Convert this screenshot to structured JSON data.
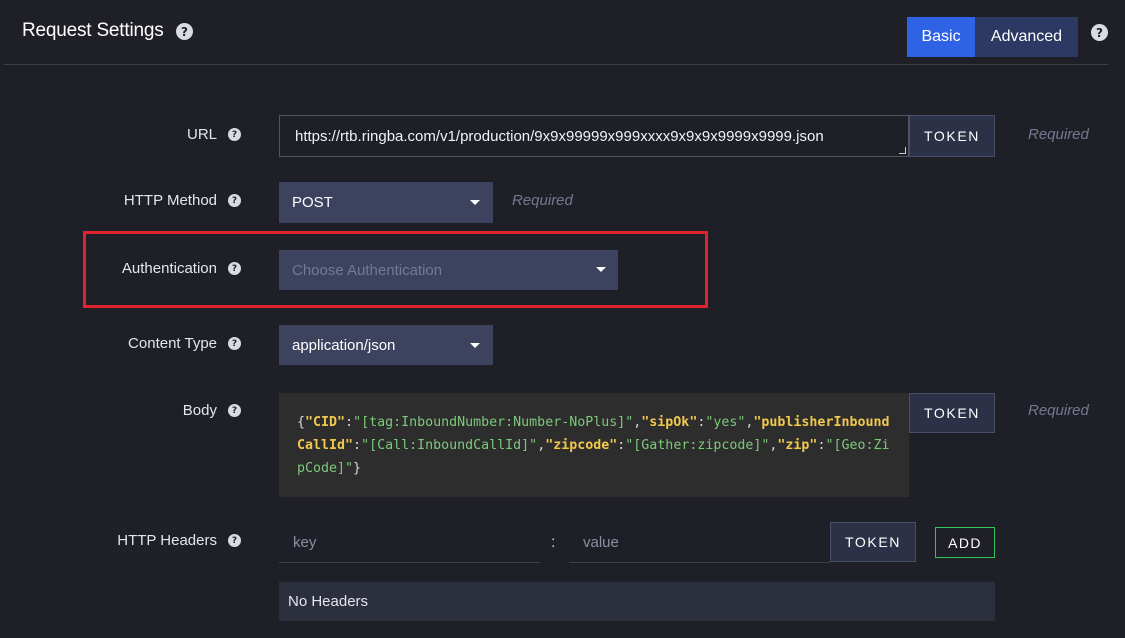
{
  "header": {
    "title": "Request Settings",
    "help_glyph": "?",
    "modes": {
      "basic": "Basic",
      "advanced": "Advanced",
      "active": "Basic"
    }
  },
  "url": {
    "label": "URL",
    "value": "https://rtb.ringba.com/v1/production/9x9x99999x999xxxx9x9x9x9999x9999.json",
    "token": "TOKEN",
    "required": "Required"
  },
  "http_method": {
    "label": "HTTP Method",
    "value": "POST",
    "required": "Required"
  },
  "authentication": {
    "label": "Authentication",
    "placeholder": "Choose Authentication"
  },
  "content_type": {
    "label": "Content Type",
    "value": "application/json"
  },
  "body": {
    "label": "Body",
    "token": "TOKEN",
    "required": "Required",
    "json_pairs": [
      {
        "key": "\"CID\"",
        "value": "\"[tag:InboundNumber:Number-NoPlus]\""
      },
      {
        "key": "\"sipOk\"",
        "value": "\"yes\""
      },
      {
        "key": "\"publisherInboundCallId\"",
        "value": "\"[Call:InboundCallId]\""
      },
      {
        "key": "\"zipcode\"",
        "value": "\"[Gather:zipcode]\""
      },
      {
        "key": "\"zip\"",
        "value": "\"[Geo:ZipCode]\""
      }
    ]
  },
  "http_headers": {
    "label": "HTTP Headers",
    "key_placeholder": "key",
    "separator": ":",
    "value_placeholder": "value",
    "token": "TOKEN",
    "add": "ADD",
    "empty_text": "No Headers"
  },
  "colors": {
    "background": "#1f2027",
    "active_mode": "#2f63e6",
    "inactive_mode": "#2c3a63",
    "select_bg": "#3d435e",
    "highlight": "#e0232e",
    "json_key": "#f2c94c",
    "json_value": "#7cc97a",
    "add_border": "#36c25b"
  },
  "icons": {
    "help": "question-circle-icon",
    "caret": "caret-down-icon",
    "resize": "resize-grip-icon"
  }
}
